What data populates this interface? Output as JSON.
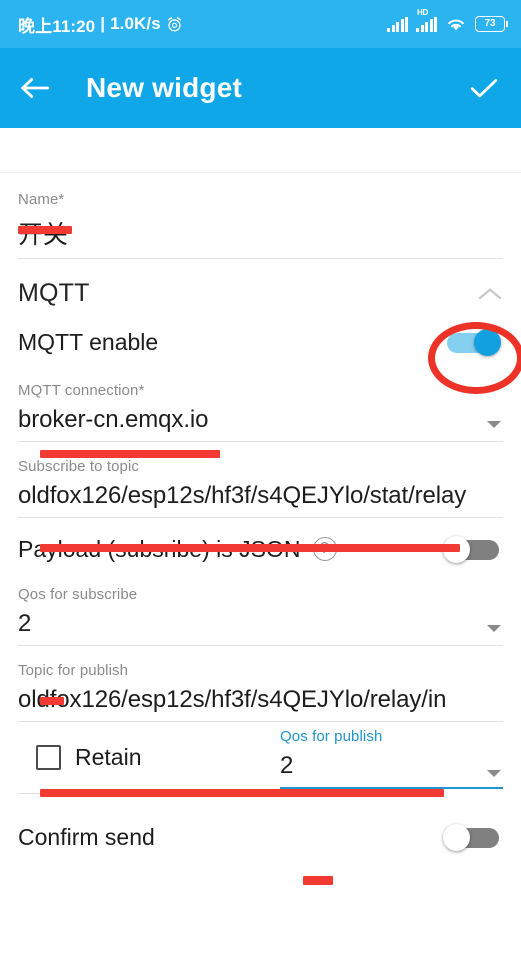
{
  "status_bar": {
    "time": "晚上11:20",
    "separator": "|",
    "net_speed": "1.0K/s",
    "alarm_icon": "alarm-clock-icon",
    "hd_label": "HD",
    "battery_percent": "73",
    "wifi_icon": "wifi-icon",
    "signal_icon": "signal-bars-icon"
  },
  "app_bar": {
    "back_icon": "arrow-left-icon",
    "title": "New widget",
    "confirm_icon": "check-icon"
  },
  "form": {
    "name": {
      "label": "Name*",
      "value": "开关"
    },
    "section": {
      "title": "MQTT",
      "collapse_icon": "chevron-up-icon"
    },
    "mqtt_enable": {
      "label": "MQTT enable",
      "state": "on"
    },
    "mqtt_connection": {
      "label": "MQTT connection*",
      "value": "broker-cn.emqx.io"
    },
    "subscribe_topic": {
      "label": "Subscribe to topic",
      "value": "oldfox126/esp12s/hf3f/s4QEJYlo/stat/relay"
    },
    "payload_json": {
      "label": "Payload (subsribe) is JSON",
      "help_icon": "help-circle-icon",
      "state": "off"
    },
    "qos_subscribe": {
      "label": "Qos for subscribe",
      "value": "2"
    },
    "publish_topic": {
      "label": "Topic for publish",
      "value": "oldfox126/esp12s/hf3f/s4QEJYlo/relay/in"
    },
    "retain": {
      "label": "Retain",
      "checked": "false"
    },
    "qos_publish": {
      "label": "Qos for publish",
      "value": "2",
      "focused": "true"
    },
    "confirm_send": {
      "label": "Confirm send",
      "state": "off"
    }
  },
  "colors": {
    "status_bar": "#2BB4EF",
    "app_bar": "#0FA7E8",
    "accent_blue": "#12A0E0",
    "annotation_red": "#ED3227",
    "focus_blue": "#2196D3"
  }
}
